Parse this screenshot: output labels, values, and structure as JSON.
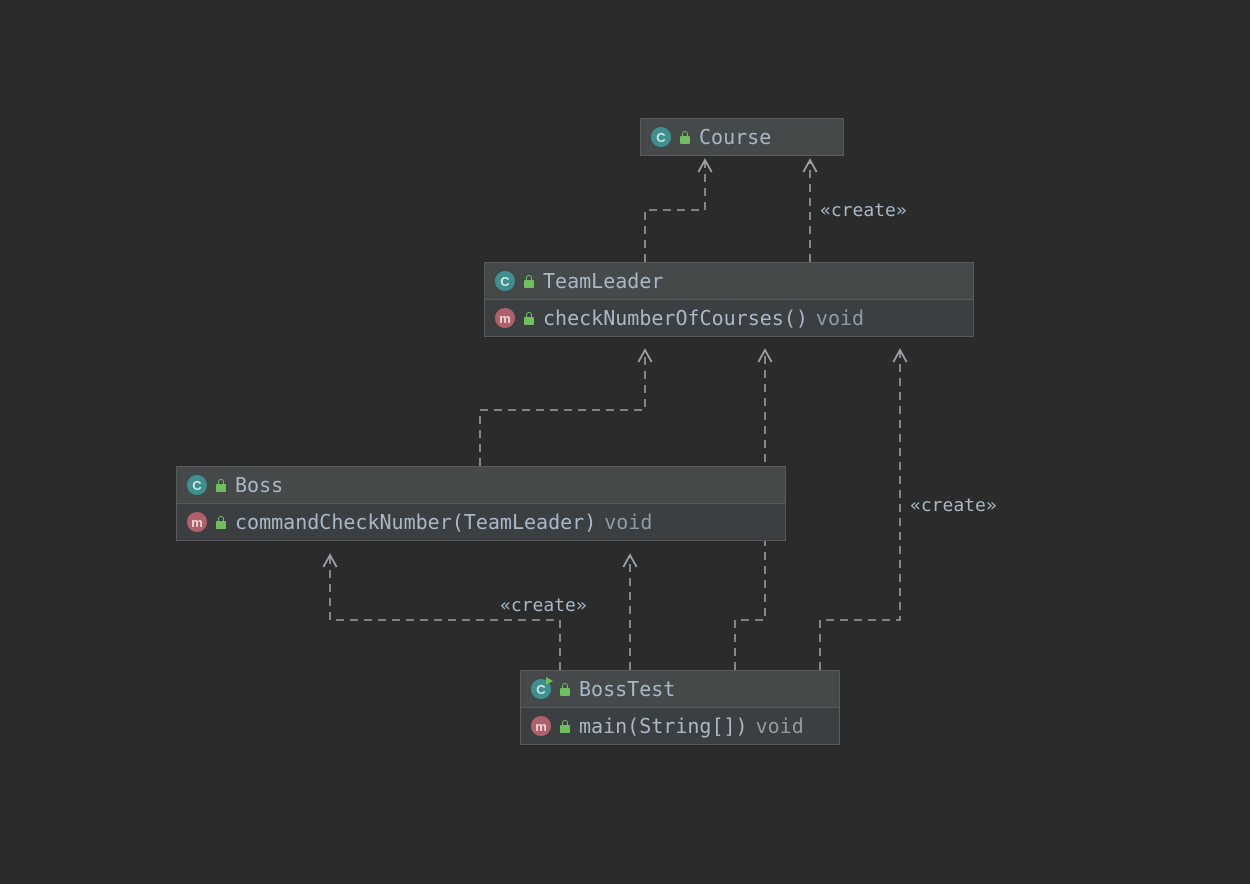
{
  "classes": {
    "course": {
      "name": "Course"
    },
    "teamleader": {
      "name": "TeamLeader",
      "method": "checkNumberOfCourses()",
      "ret": "void"
    },
    "boss": {
      "name": "Boss",
      "method": "commandCheckNumber(TeamLeader)",
      "ret": "void"
    },
    "bosstest": {
      "name": "BossTest",
      "method": "main(String[])",
      "ret": "void"
    }
  },
  "labels": {
    "create": "«create»"
  },
  "edges": [
    {
      "from": "teamleader",
      "to": "course",
      "label": null
    },
    {
      "from": "teamleader",
      "to": "course",
      "label": "«create»"
    },
    {
      "from": "boss",
      "to": "teamleader",
      "label": null
    },
    {
      "from": "bosstest",
      "to": "teamleader",
      "label": null
    },
    {
      "from": "bosstest",
      "to": "teamleader",
      "label": "«create»"
    },
    {
      "from": "bosstest",
      "to": "boss",
      "label": null
    },
    {
      "from": "bosstest",
      "to": "boss",
      "label": "«create»"
    }
  ]
}
